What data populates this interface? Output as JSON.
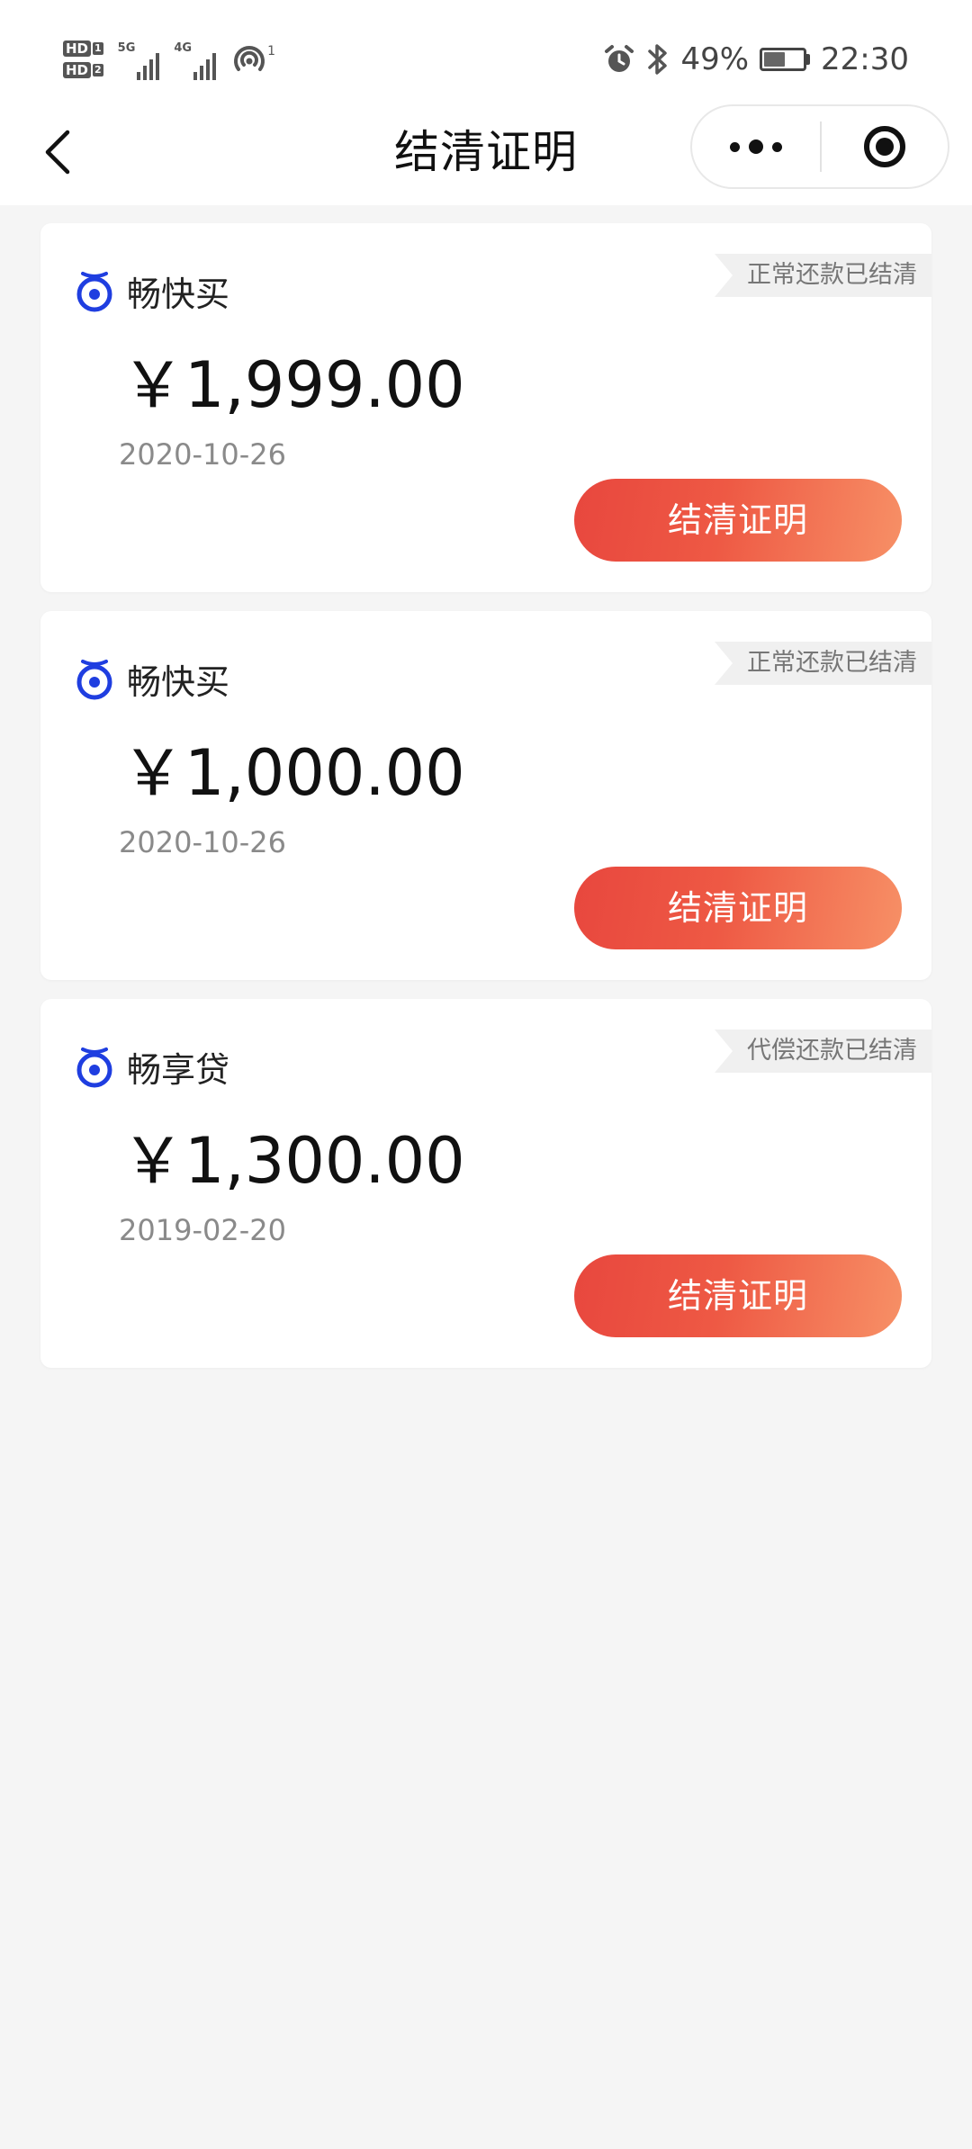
{
  "status_bar": {
    "sim1": "HD",
    "sim1_num": "1",
    "sim2": "HD",
    "sim2_num": "2",
    "net1": "5G",
    "net2": "4G",
    "hotspot_count": "1",
    "battery_percent": "49%",
    "battery_level": 0.49,
    "time": "22:30",
    "icons": [
      "alarm-icon",
      "bluetooth-icon",
      "battery-icon",
      "hotspot-icon"
    ]
  },
  "nav": {
    "title": "结清证明",
    "back_icon": "chevron-left-icon",
    "more_icon": "more-dots-icon",
    "close_icon": "target-icon"
  },
  "colors": {
    "brand_blue": "#1f3ee0",
    "button_start": "#e8473e",
    "button_end": "#f79066",
    "tag_bg": "#f0f0f0",
    "tag_text": "#777777",
    "page_bg": "#f5f5f5"
  },
  "cards": [
    {
      "brand": "畅快买",
      "status": "正常还款已结清",
      "amount": "￥1,999.00",
      "date": "2020-10-26",
      "button": "结清证明"
    },
    {
      "brand": "畅快买",
      "status": "正常还款已结清",
      "amount": "￥1,000.00",
      "date": "2020-10-26",
      "button": "结清证明"
    },
    {
      "brand": "畅享贷",
      "status": "代偿还款已结清",
      "amount": "￥1,300.00",
      "date": "2019-02-20",
      "button": "结清证明"
    }
  ]
}
